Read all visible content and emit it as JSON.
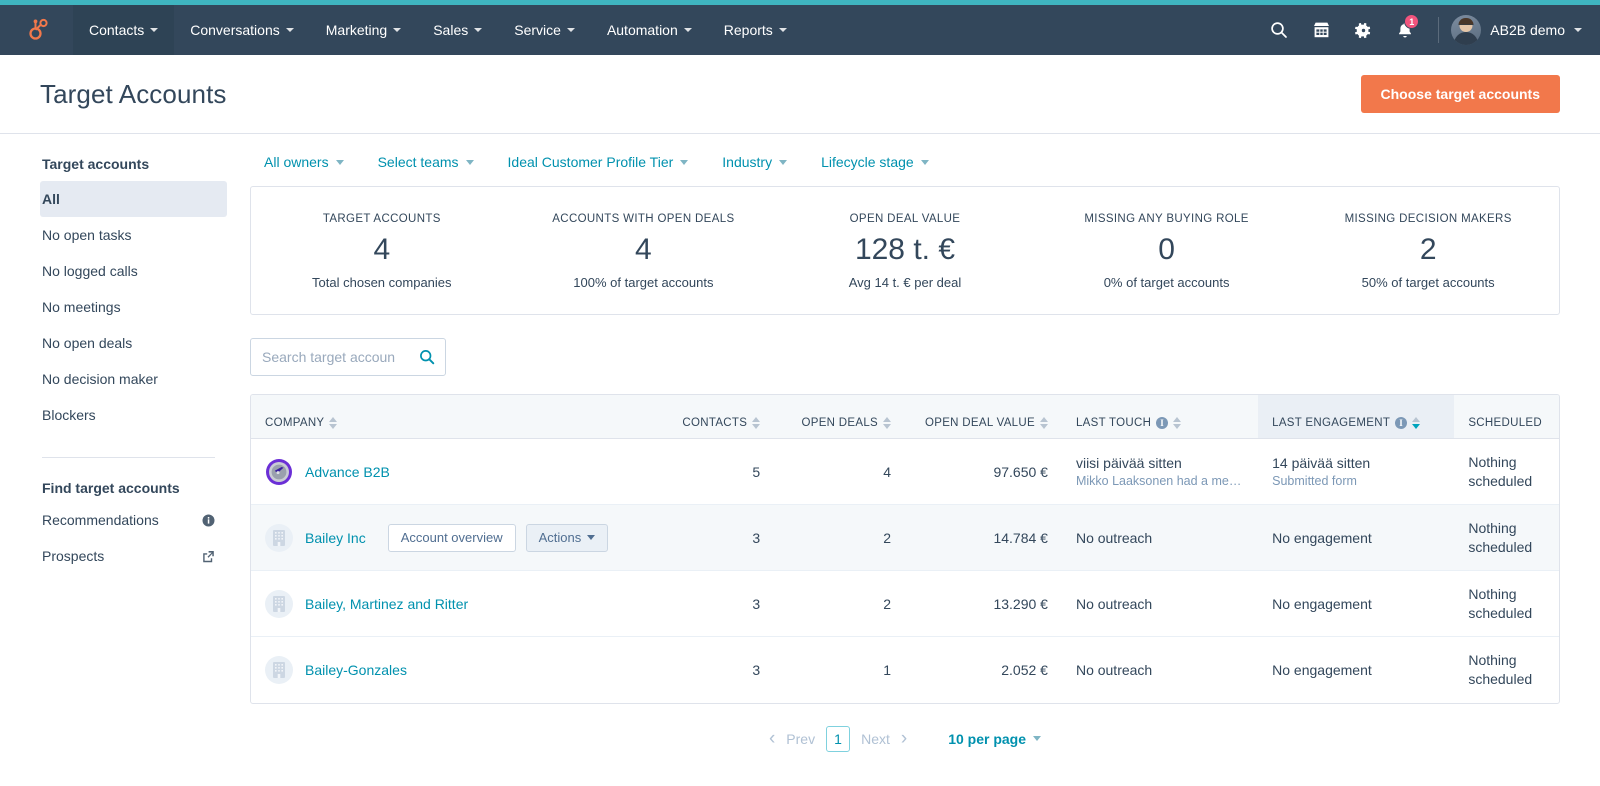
{
  "theme": {
    "nav_bg": "#33475b",
    "accent_teal": "#3fb5c0",
    "link_blue": "#0091ae",
    "primary_orange": "#f2784b",
    "text": "#33475b"
  },
  "topnav": {
    "logo_name": "hubspot-sprocket-logo",
    "items": [
      {
        "label": "Contacts",
        "active": true
      },
      {
        "label": "Conversations",
        "active": false
      },
      {
        "label": "Marketing",
        "active": false
      },
      {
        "label": "Sales",
        "active": false
      },
      {
        "label": "Service",
        "active": false
      },
      {
        "label": "Automation",
        "active": false
      },
      {
        "label": "Reports",
        "active": false
      }
    ],
    "notifications_count": "1",
    "user_label": "AB2B demo"
  },
  "header": {
    "title": "Target Accounts",
    "primary_button": "Choose target accounts"
  },
  "sidebar": {
    "section_title": "Target accounts",
    "items": [
      {
        "label": "All",
        "active": true,
        "trail": ""
      },
      {
        "label": "No open tasks",
        "active": false,
        "trail": ""
      },
      {
        "label": "No logged calls",
        "active": false,
        "trail": ""
      },
      {
        "label": "No meetings",
        "active": false,
        "trail": ""
      },
      {
        "label": "No open deals",
        "active": false,
        "trail": ""
      },
      {
        "label": "No decision maker",
        "active": false,
        "trail": ""
      },
      {
        "label": "Blockers",
        "active": false,
        "trail": ""
      }
    ],
    "section_title2": "Find target accounts",
    "items2": [
      {
        "label": "Recommendations",
        "trail": "info"
      },
      {
        "label": "Prospects",
        "trail": "external"
      }
    ]
  },
  "filters": [
    {
      "label": "All owners"
    },
    {
      "label": "Select teams"
    },
    {
      "label": "Ideal Customer Profile Tier"
    },
    {
      "label": "Industry"
    },
    {
      "label": "Lifecycle stage"
    }
  ],
  "stats": [
    {
      "label": "TARGET ACCOUNTS",
      "value": "4",
      "sub": "Total chosen companies"
    },
    {
      "label": "ACCOUNTS WITH OPEN DEALS",
      "value": "4",
      "sub": "100% of target accounts"
    },
    {
      "label": "OPEN DEAL VALUE",
      "value": "128 t. €",
      "sub": "Avg 14 t. € per deal"
    },
    {
      "label": "MISSING ANY BUYING ROLE",
      "value": "0",
      "sub": "0% of target accounts"
    },
    {
      "label": "MISSING DECISION MAKERS",
      "value": "2",
      "sub": "50% of target accounts"
    }
  ],
  "search": {
    "value": "",
    "placeholder": "Search target accoun"
  },
  "table": {
    "columns": [
      {
        "label": "COMPANY",
        "align": "left",
        "sortable": true,
        "info": false,
        "sorted": false
      },
      {
        "label": "CONTACTS",
        "align": "right",
        "sortable": true,
        "info": false,
        "sorted": false
      },
      {
        "label": "OPEN DEALS",
        "align": "right",
        "sortable": true,
        "info": false,
        "sorted": false
      },
      {
        "label": "OPEN DEAL VALUE",
        "align": "right",
        "sortable": true,
        "info": false,
        "sorted": false
      },
      {
        "label": "LAST TOUCH",
        "align": "left",
        "sortable": true,
        "info": true,
        "sorted": false
      },
      {
        "label": "LAST ENGAGEMENT",
        "align": "left",
        "sortable": true,
        "info": true,
        "sorted": true
      },
      {
        "label": "SCHEDULED",
        "align": "left",
        "sortable": false,
        "info": false,
        "sorted": false
      }
    ],
    "rows": [
      {
        "company": "Advance B2B",
        "logo": "advance-b2b-logo",
        "hovered": false,
        "contacts": "5",
        "open_deals": "4",
        "open_deal_value": "97.650 €",
        "last_touch_main": "viisi päivää sitten",
        "last_touch_sub": "Mikko Laaksonen had a me…",
        "last_engagement_main": "14 päivää sitten",
        "last_engagement_sub": "Submitted form",
        "scheduled": "Nothing scheduled"
      },
      {
        "company": "Bailey Inc",
        "logo": "generic-company-icon",
        "hovered": true,
        "row_buttons": [
          {
            "label": "Account overview",
            "tinted": false,
            "caret": false
          },
          {
            "label": "Actions",
            "tinted": true,
            "caret": true
          }
        ],
        "contacts": "3",
        "open_deals": "2",
        "open_deal_value": "14.784 €",
        "last_touch_main": "No outreach",
        "last_touch_sub": "",
        "last_engagement_main": "No engagement",
        "last_engagement_sub": "",
        "scheduled": "Nothing scheduled"
      },
      {
        "company": "Bailey, Martinez and Ritter",
        "logo": "generic-company-icon",
        "hovered": false,
        "contacts": "3",
        "open_deals": "2",
        "open_deal_value": "13.290 €",
        "last_touch_main": "No outreach",
        "last_touch_sub": "",
        "last_engagement_main": "No engagement",
        "last_engagement_sub": "",
        "scheduled": "Nothing scheduled"
      },
      {
        "company": "Bailey-Gonzales",
        "logo": "generic-company-icon",
        "hovered": false,
        "contacts": "3",
        "open_deals": "1",
        "open_deal_value": "2.052 €",
        "last_touch_main": "No outreach",
        "last_touch_sub": "",
        "last_engagement_main": "No engagement",
        "last_engagement_sub": "",
        "scheduled": "Nothing scheduled"
      }
    ]
  },
  "pagination": {
    "prev": "Prev",
    "current_page": "1",
    "next": "Next",
    "per_page": "10 per page"
  }
}
